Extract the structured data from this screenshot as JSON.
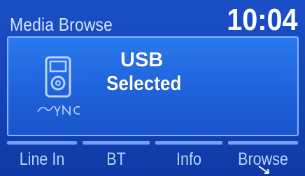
{
  "header": {
    "title": "Media Browse",
    "time": "10:04"
  },
  "main": {
    "source_line1": "USB",
    "source_line2": "Selected",
    "logo_text": "SYNC",
    "icon": "ipod-sync-icon"
  },
  "softkeys": [
    {
      "label": "Line In"
    },
    {
      "label": "BT"
    },
    {
      "label": "Info"
    },
    {
      "label": "Browse"
    }
  ],
  "colors": {
    "background": "#0f3aa6",
    "panel": "#2270e3",
    "panel_border": "#7fb6ff",
    "softkey_text": "#b7d2ff",
    "title_text": "#cfe2ff"
  }
}
